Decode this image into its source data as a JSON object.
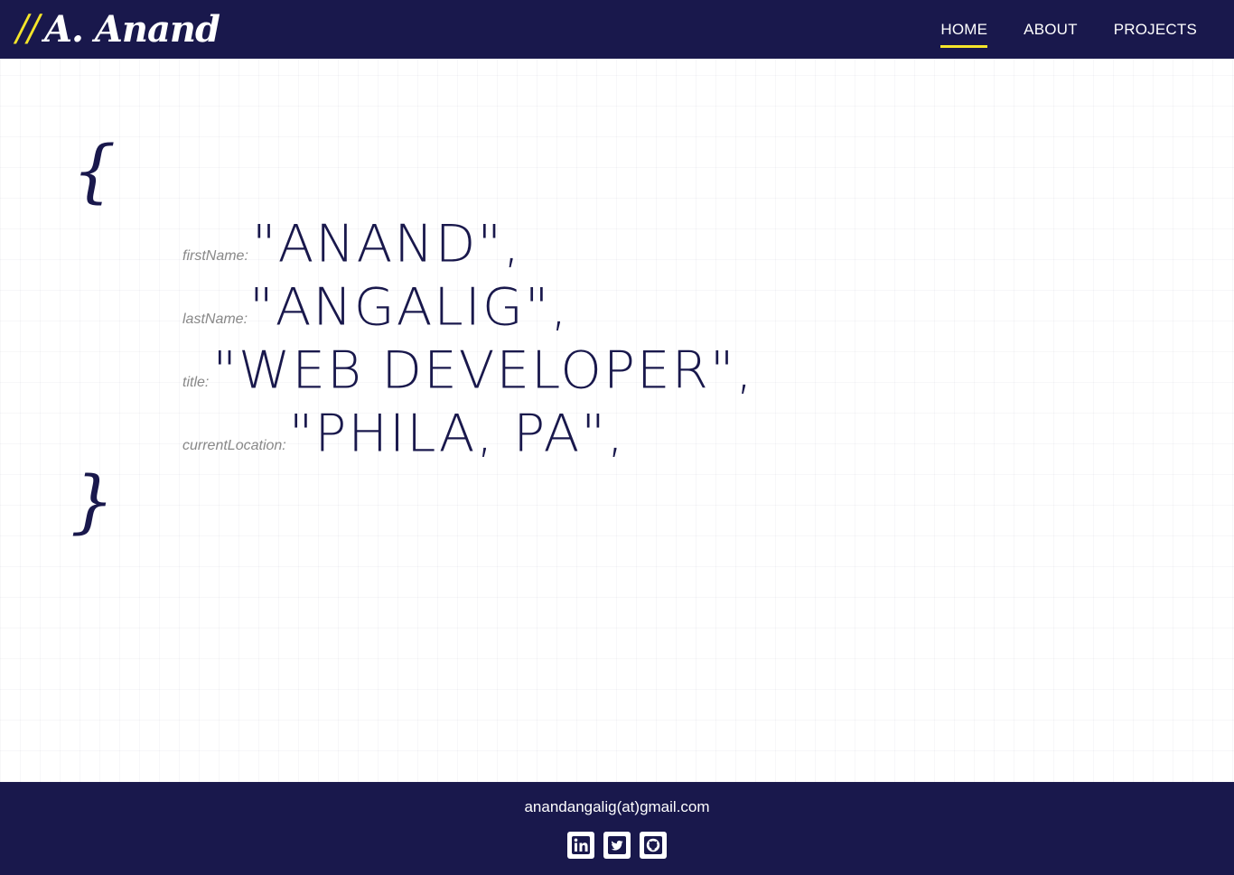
{
  "nav": {
    "brand_slashes": "//",
    "brand_name": "A. Anand",
    "links": [
      {
        "label": "HOME",
        "active": true
      },
      {
        "label": "ABOUT",
        "active": false
      },
      {
        "label": "PROJECTS",
        "active": false
      }
    ]
  },
  "profile": {
    "open_brace": "{",
    "close_brace": "}",
    "fields": [
      {
        "key": "firstName:",
        "value": "\"ANAND\","
      },
      {
        "key": "lastName:",
        "value": "\"ANGALIG\","
      },
      {
        "key": "title:",
        "value": "\"WEB DEVELOPER\","
      },
      {
        "key": "currentLocation:",
        "value": "\"PHILA, PA\","
      }
    ]
  },
  "footer": {
    "email": "anandangalig(at)gmail.com",
    "social_icons": [
      "linkedin-icon",
      "twitter-icon",
      "github-icon"
    ]
  },
  "colors": {
    "navy": "#19184c",
    "accent_yellow": "#f5e52a",
    "key_gray": "#888888"
  }
}
